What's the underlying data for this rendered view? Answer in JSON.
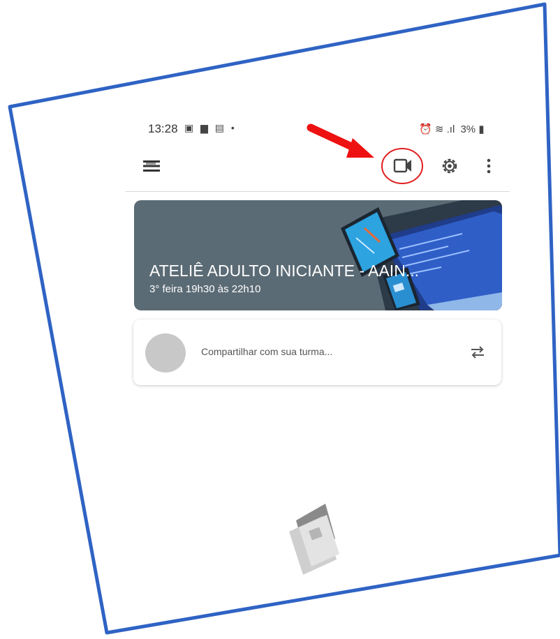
{
  "status_bar": {
    "time": "13:28",
    "left_icons": "▣ ▆ ▤ •",
    "battery": "3%"
  },
  "toolbar": {
    "menu_icon": "menu-icon",
    "video_icon": "video-camera-icon",
    "settings_icon": "gear-icon",
    "more_icon": "more-vertical-icon"
  },
  "class_banner": {
    "title": "ATELIÊ ADULTO INICIANTE - AAIN...",
    "schedule": "3° feira 19h30 às 22h10"
  },
  "share_box": {
    "placeholder": "Compartilhar com sua turma..."
  },
  "annotations": {
    "arrow_color": "#ee1111",
    "highlight_circle_color": "#e02020",
    "frame_color": "#2f63c4"
  }
}
